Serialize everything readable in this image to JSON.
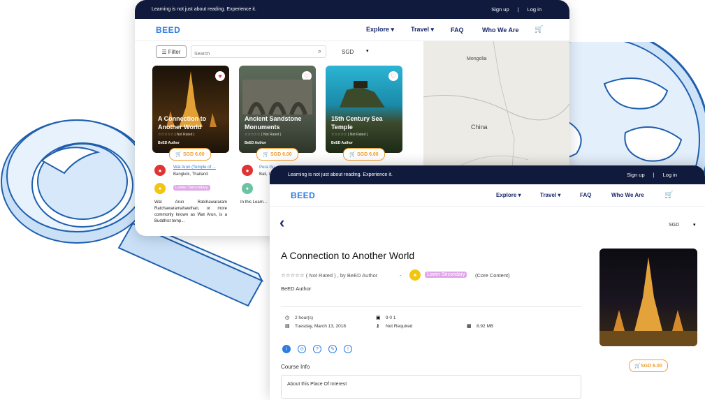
{
  "topbar": {
    "tagline": "Learning is not just about reading. Experience it.",
    "signup": "Sign up",
    "separator": "|",
    "login": "Log in"
  },
  "brand": {
    "logo": "BEED",
    "accent": "#2d7be5",
    "navy": "#0f1a3d",
    "orange": "#f29b2b"
  },
  "nav": {
    "explore": "Explore ▾",
    "travel": "Travel ▾",
    "faq": "FAQ",
    "who": "Who We Are"
  },
  "search": {
    "filter": "Filter",
    "placeholder": "Search",
    "currency": "SGD"
  },
  "map": {
    "label1": "Mongolia",
    "label2": "China"
  },
  "cards": [
    {
      "title": "A Connection to Another World",
      "rating": "☆☆☆☆☆ ( Not Rated )",
      "author": "BeED Author",
      "price": "SGD 6.00"
    },
    {
      "title": "Ancient Sandstone Monuments",
      "rating": "☆☆☆☆☆ ( Not Rated )",
      "author": "BeED Author",
      "price": "SGD 6.00"
    },
    {
      "title": "15th Century Sea Temple",
      "rating": "☆☆☆☆☆ ( Not Rated )",
      "author": "BeED Author",
      "price": "SGD 6.00"
    }
  ],
  "card1_detail": {
    "place": "Wat Arun (Temple of ...",
    "location": "Bangkok, Thailand",
    "level": "Lower Secondary",
    "desc": "Wat Arun Ratchawararam Ratchawaramahawihan, or more commonly known as Wat Arun, is a Buddhist temp..."
  },
  "card2_detail": {
    "place": "Pura Gu...",
    "location": "Bali, I...",
    "desc": "In this Learn... will learn h... deteriorate... monuments,..."
  },
  "detail": {
    "back": "‹",
    "currency": "SGD",
    "title": "A Connection to Another World",
    "rating": "☆☆☆☆☆ ( Not Rated ) , by BeED Author",
    "dash": "-",
    "level": "Lower Secondary",
    "core": "(Core Content)",
    "author": "BeED Author",
    "duration": "2 hour(s)",
    "date": "Tuesday, March 13, 2018",
    "media": "9 0 1",
    "equipment": "Not Required",
    "size": "8.92 MB",
    "course_info": "Course Info",
    "about": "About this Place Of Interest",
    "price": "SGD 6.00"
  }
}
